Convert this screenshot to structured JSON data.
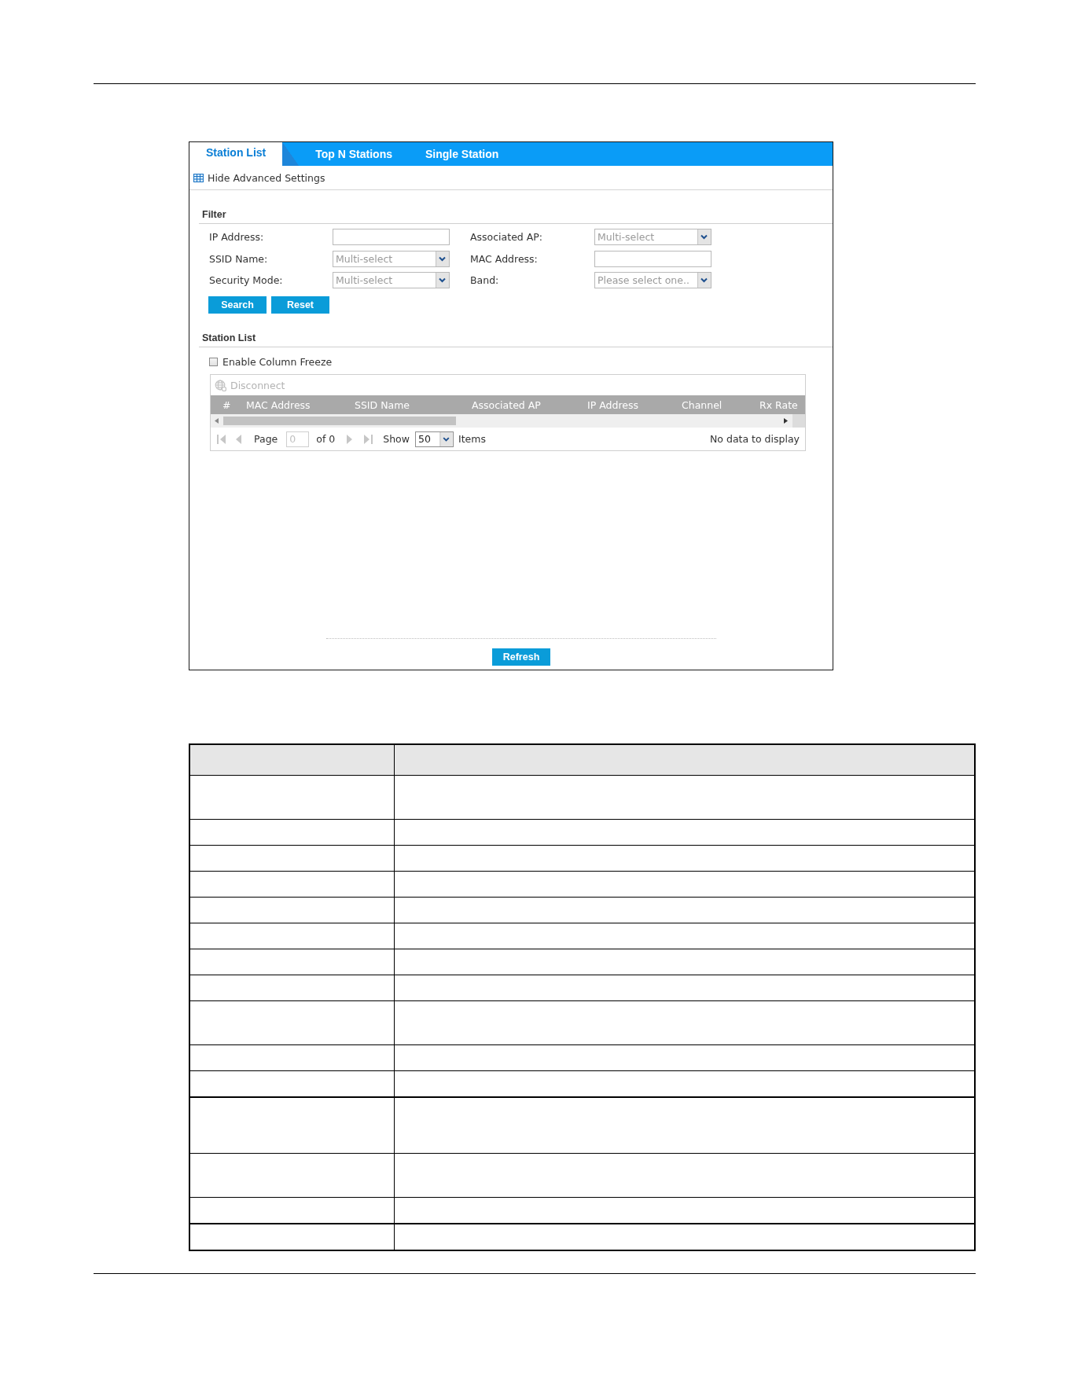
{
  "tabs": [
    {
      "label": "Station List",
      "selected": true
    },
    {
      "label": "Top N Stations",
      "selected": false
    },
    {
      "label": "Single Station",
      "selected": false
    }
  ],
  "advanced_toggle": {
    "label": "Hide Advanced Settings"
  },
  "filter": {
    "heading": "Filter",
    "fields": [
      {
        "label": "IP Address:",
        "kind": "text"
      },
      {
        "label": "Associated AP:",
        "kind": "select",
        "placeholder": "Multi-select"
      },
      {
        "label": "SSID Name:",
        "kind": "select",
        "placeholder": "Multi-select"
      },
      {
        "label": "MAC Address:",
        "kind": "text"
      },
      {
        "label": "Security Mode:",
        "kind": "select",
        "placeholder": "Multi-select"
      },
      {
        "label": "Band:",
        "kind": "select",
        "placeholder": "Please select one.."
      }
    ],
    "buttons": [
      "Search",
      "Reset"
    ]
  },
  "station_list": {
    "heading": "Station List",
    "column_freeze": {
      "label": "Enable Column Freeze",
      "checked": false
    },
    "disconnect": {
      "label": "Disconnect",
      "disabled": true
    },
    "columns": [
      "#",
      "MAC Address",
      "SSID Name",
      "Associated AP",
      "IP Address",
      "Channel",
      "Rx Rate"
    ],
    "pager": {
      "nav": [
        {
          "kind": "first",
          "disabled": true
        },
        {
          "kind": "previous",
          "disabled": true
        },
        {
          "kind": "next",
          "disabled": true
        },
        {
          "kind": "last",
          "disabled": true
        }
      ],
      "page_label": "Page",
      "page_field": {
        "value": "0",
        "disabled": true
      },
      "page_count": "of 0",
      "show_label": "Show",
      "page_size": "50",
      "items_label": "Items",
      "message": "No data to display"
    }
  },
  "refresh_button": "Refresh",
  "description_table": {
    "rows": [
      {
        "kind": "double",
        "section_start": false
      },
      {
        "kind": "single",
        "section_start": false
      },
      {
        "kind": "single",
        "section_start": false
      },
      {
        "kind": "single",
        "section_start": false
      },
      {
        "kind": "single",
        "section_start": false
      },
      {
        "kind": "single",
        "section_start": false
      },
      {
        "kind": "single",
        "section_start": false
      },
      {
        "kind": "single",
        "section_start": false
      },
      {
        "kind": "double",
        "section_start": false
      },
      {
        "kind": "single",
        "section_start": false
      },
      {
        "kind": "single",
        "section_start": false
      },
      {
        "kind": "triple",
        "section_start": true
      },
      {
        "kind": "double",
        "section_start": false
      },
      {
        "kind": "single",
        "section_start": false
      },
      {
        "kind": "single",
        "section_start": true
      }
    ]
  }
}
